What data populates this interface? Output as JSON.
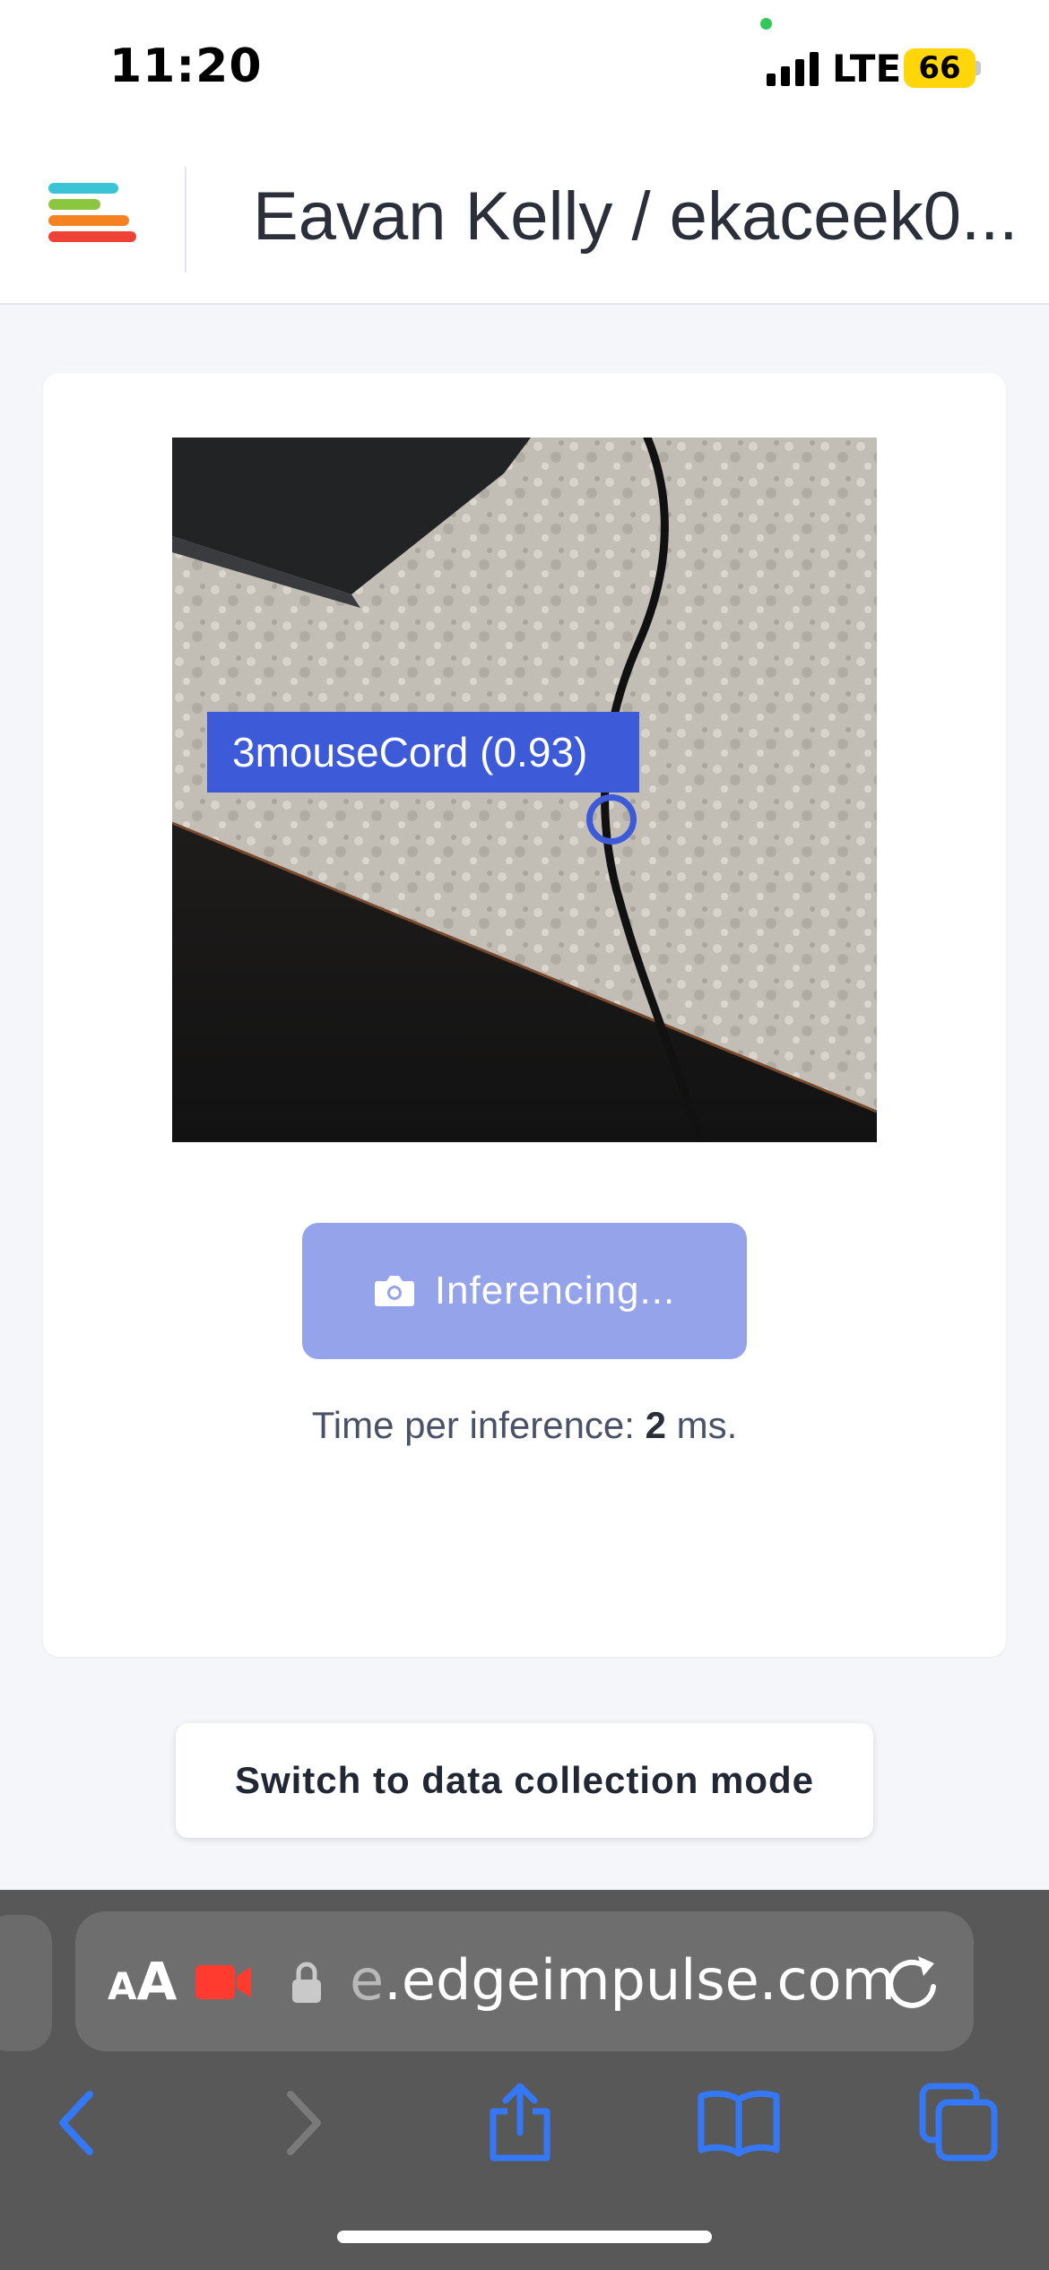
{
  "status_bar": {
    "time": "11:20",
    "network": "LTE",
    "battery": "66"
  },
  "header": {
    "project_title": "Eavan Kelly / ekaceek0...",
    "logo_colors": [
      "#3bc3d6",
      "#8cc63f",
      "#f58220",
      "#ef4136"
    ]
  },
  "camera": {
    "detection": {
      "label": "3mouseCord (0.93)"
    }
  },
  "inference": {
    "button_label": "Inferencing...",
    "time_prefix": "Time per inference: ",
    "time_value": "2",
    "time_suffix": " ms."
  },
  "switch_button_label": "Switch to data collection mode",
  "browser": {
    "aa_small": "A",
    "aa_big": "A",
    "url_faded": "e",
    "url_main": ".edgeimpulse.com"
  },
  "colors": {
    "accent": "#3d5bd8",
    "button_disabled": "#95a3eb",
    "safari_icons": "#3478f6"
  }
}
